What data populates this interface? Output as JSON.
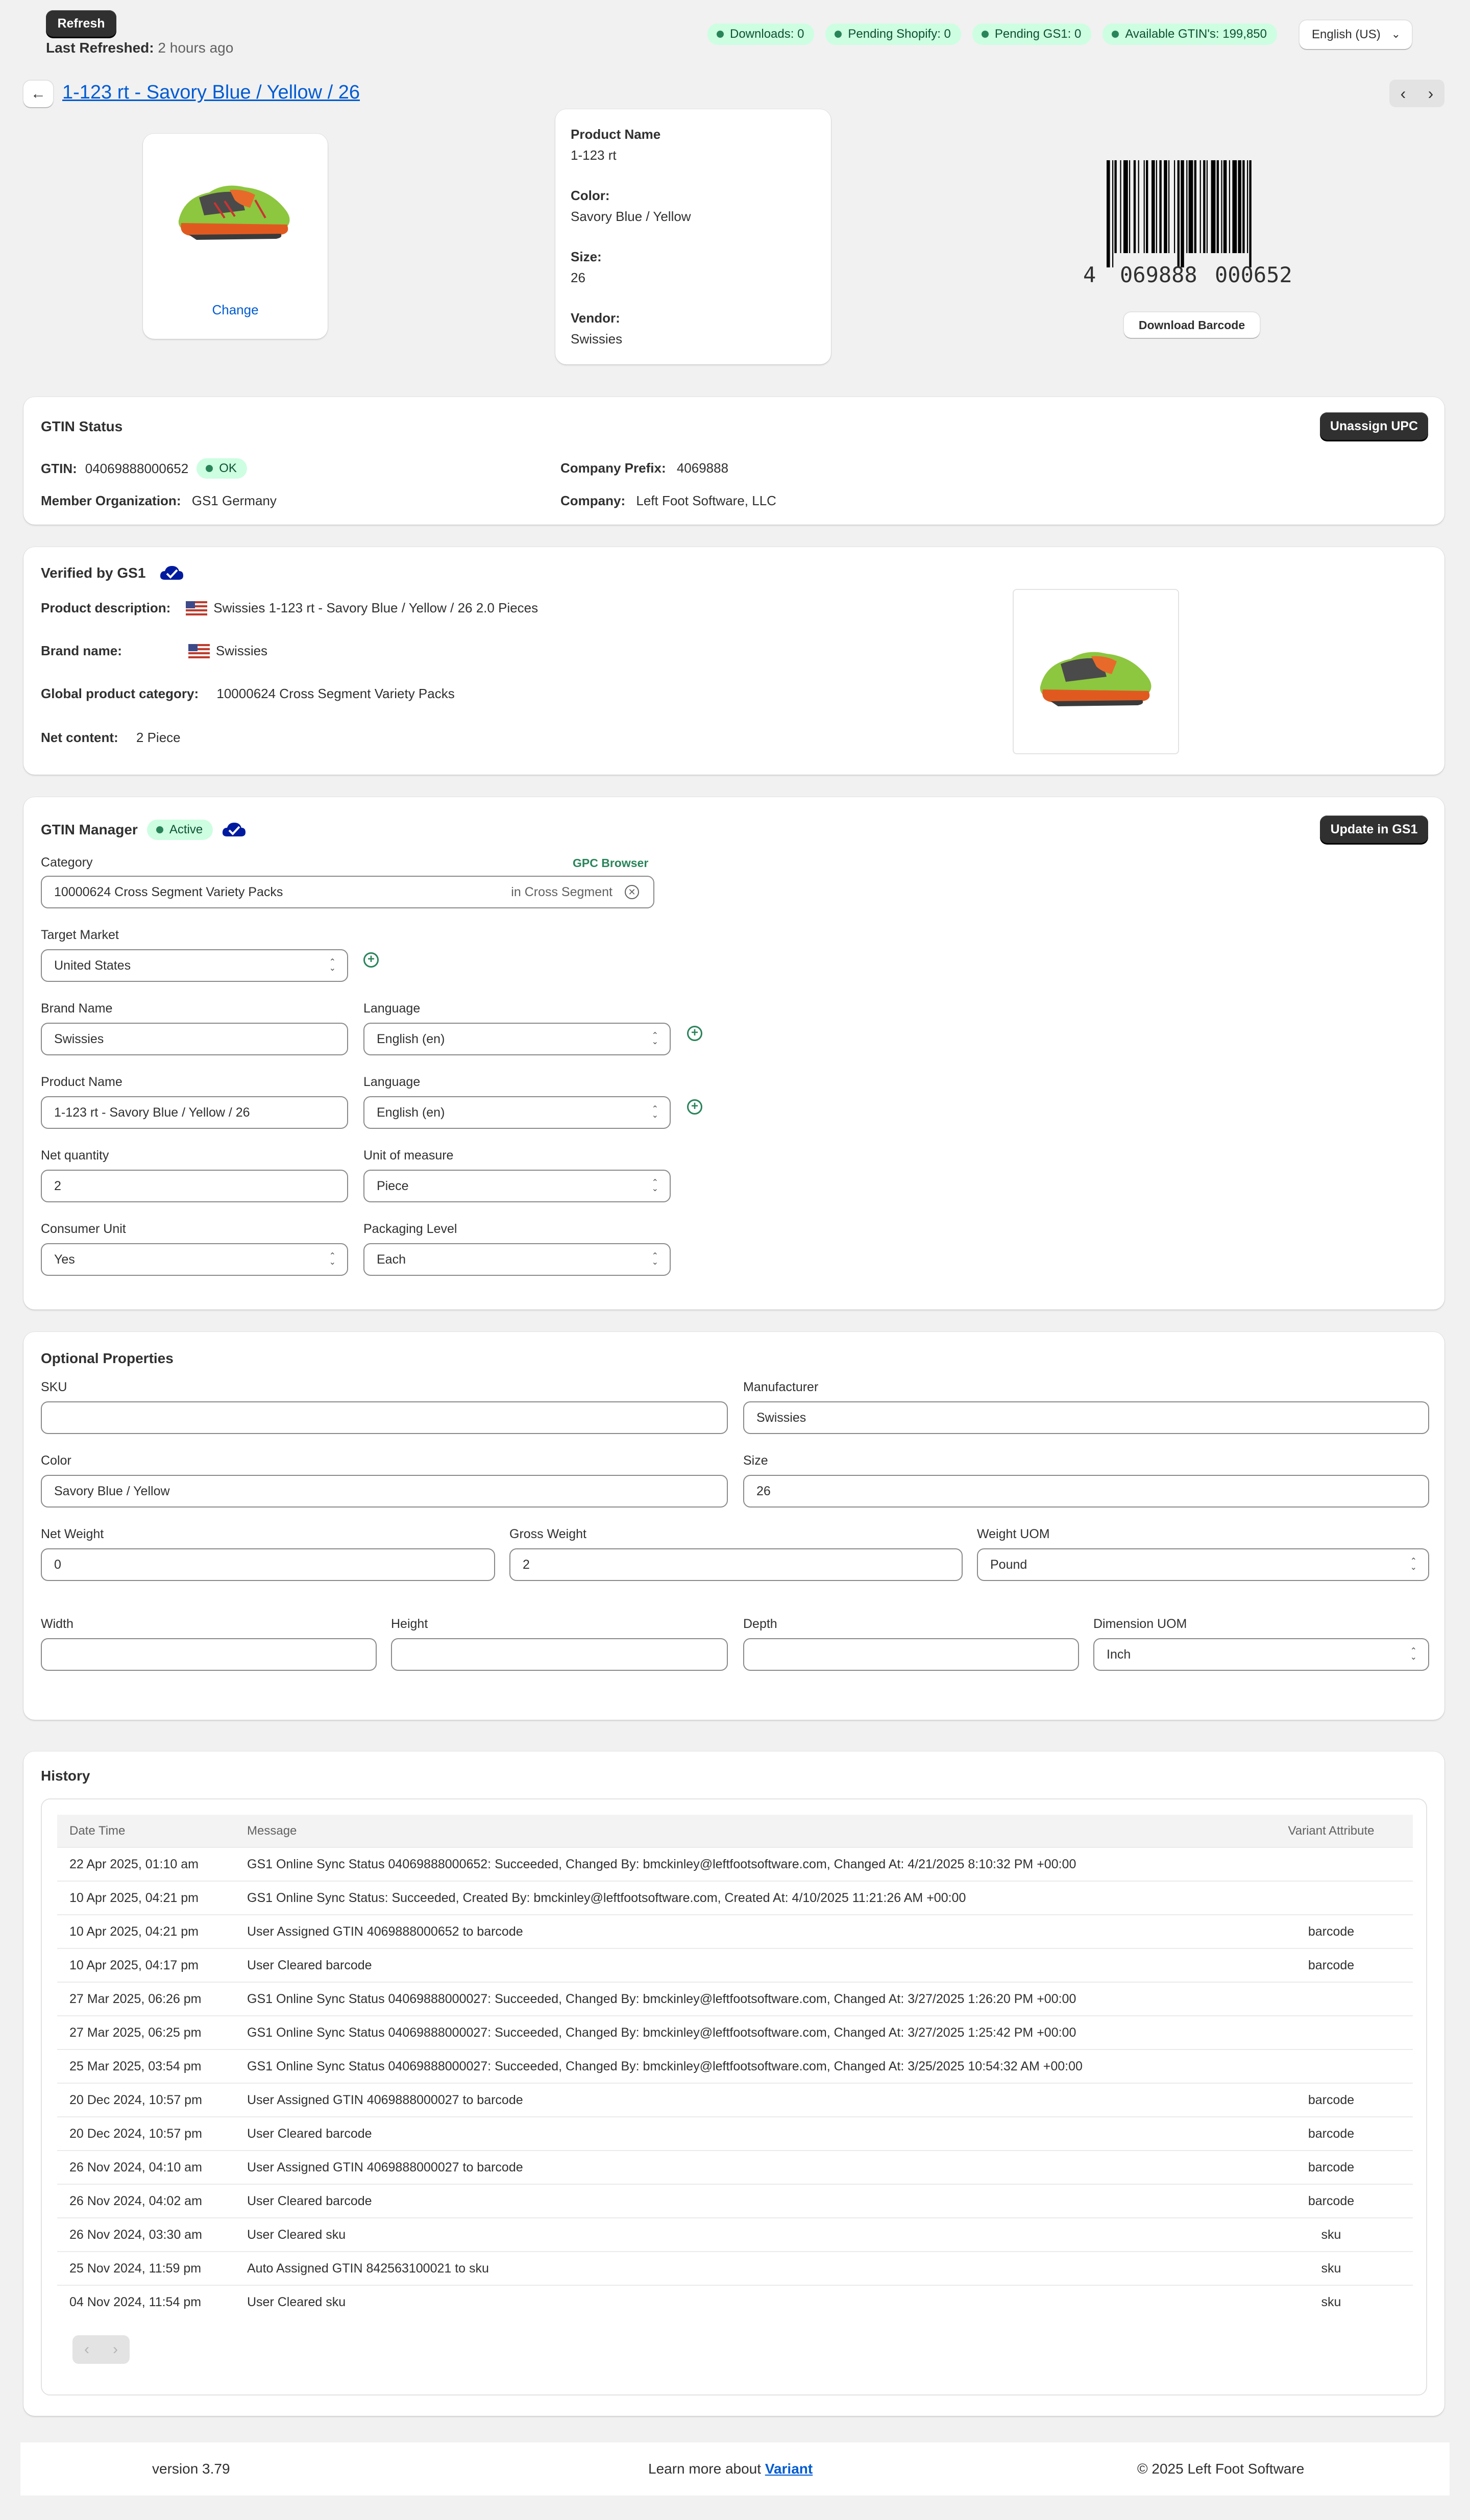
{
  "header": {
    "refresh_label": "Refresh",
    "last_refreshed_label": "Last Refreshed:",
    "last_refreshed_value": "2 hours ago",
    "badges": [
      "Downloads: 0",
      "Pending Shopify: 0",
      "Pending GS1: 0",
      "Available GTIN's: 199,850"
    ],
    "language": "English (US)"
  },
  "title": "1-123 rt - Savory Blue / Yellow / 26",
  "product": {
    "change_label": "Change",
    "name_label": "Product Name",
    "name": "1-123 rt",
    "color_label": "Color:",
    "color": "Savory Blue / Yellow",
    "size_label": "Size:",
    "size": "26",
    "vendor_label": "Vendor:",
    "vendor": "Swissies"
  },
  "barcode": {
    "digit_first": "4",
    "digits_left": "069888",
    "digits_right": "000652",
    "download_label": "Download Barcode"
  },
  "gtin_status": {
    "title": "GTIN Status",
    "unassign_label": "Unassign UPC",
    "gtin_label": "GTIN:",
    "gtin": "04069888000652",
    "status": "OK",
    "prefix_label": "Company Prefix:",
    "prefix": "4069888",
    "member_label": "Member Organization:",
    "member": "GS1 Germany",
    "company_label": "Company:",
    "company": "Left Foot Software, LLC"
  },
  "verified": {
    "title": "Verified by GS1",
    "desc_label": "Product description:",
    "desc": "Swissies 1-123 rt - Savory Blue / Yellow / 26 2.0 Pieces",
    "brand_label": "Brand name:",
    "brand": "Swissies",
    "category_label": "Global product category:",
    "category": "10000624 Cross Segment Variety Packs",
    "net_label": "Net content:",
    "net": "2 Piece"
  },
  "manager": {
    "title": "GTIN Manager",
    "status": "Active",
    "update_label": "Update in GS1",
    "category_label": "Category",
    "gpc_label": "GPC Browser",
    "category_value": "10000624 Cross Segment Variety Packs",
    "category_suffix": "in Cross Segment",
    "target_market_label": "Target Market",
    "target_market": "United States",
    "brand_label": "Brand Name",
    "brand": "Swissies",
    "language_label": "Language",
    "brand_language": "English (en)",
    "product_name_label": "Product Name",
    "product_name": "1-123 rt - Savory Blue / Yellow / 26",
    "product_language": "English (en)",
    "net_qty_label": "Net quantity",
    "net_qty": "2",
    "uom_label": "Unit of measure",
    "uom": "Piece",
    "consumer_label": "Consumer Unit",
    "consumer": "Yes",
    "packaging_label": "Packaging Level",
    "packaging": "Each"
  },
  "optional": {
    "title": "Optional Properties",
    "sku_label": "SKU",
    "sku": "",
    "manufacturer_label": "Manufacturer",
    "manufacturer": "Swissies",
    "color_label": "Color",
    "color": "Savory Blue / Yellow",
    "size_label": "Size",
    "size": "26",
    "net_weight_label": "Net Weight",
    "net_weight": "0",
    "gross_weight_label": "Gross Weight",
    "gross_weight": "2",
    "weight_uom_label": "Weight UOM",
    "weight_uom": "Pound",
    "width_label": "Width",
    "height_label": "Height",
    "depth_label": "Depth",
    "dimension_uom_label": "Dimension UOM",
    "dimension_uom": "Inch"
  },
  "history": {
    "title": "History",
    "columns": [
      "Date Time",
      "Message",
      "Variant Attribute"
    ],
    "rows": [
      [
        "22 Apr 2025, 01:10 am",
        "GS1 Online Sync Status 04069888000652: Succeeded, Changed By: bmckinley@leftfootsoftware.com, Changed At: 4/21/2025 8:10:32 PM +00:00",
        ""
      ],
      [
        "10 Apr 2025, 04:21 pm",
        "GS1 Online Sync Status: Succeeded, Created By: bmckinley@leftfootsoftware.com, Created At: 4/10/2025 11:21:26 AM +00:00",
        ""
      ],
      [
        "10 Apr 2025, 04:21 pm",
        "User Assigned GTIN 4069888000652 to barcode",
        "barcode"
      ],
      [
        "10 Apr 2025, 04:17 pm",
        "User Cleared barcode",
        "barcode"
      ],
      [
        "27 Mar 2025, 06:26 pm",
        "GS1 Online Sync Status 04069888000027: Succeeded, Changed By: bmckinley@leftfootsoftware.com, Changed At: 3/27/2025 1:26:20 PM +00:00",
        ""
      ],
      [
        "27 Mar 2025, 06:25 pm",
        "GS1 Online Sync Status 04069888000027: Succeeded, Changed By: bmckinley@leftfootsoftware.com, Changed At: 3/27/2025 1:25:42 PM +00:00",
        ""
      ],
      [
        "25 Mar 2025, 03:54 pm",
        "GS1 Online Sync Status 04069888000027: Succeeded, Changed By: bmckinley@leftfootsoftware.com, Changed At: 3/25/2025 10:54:32 AM +00:00",
        ""
      ],
      [
        "20 Dec 2024, 10:57 pm",
        "User Assigned GTIN 4069888000027 to barcode",
        "barcode"
      ],
      [
        "20 Dec 2024, 10:57 pm",
        "User Cleared barcode",
        "barcode"
      ],
      [
        "26 Nov 2024, 04:10 am",
        "User Assigned GTIN 4069888000027 to barcode",
        "barcode"
      ],
      [
        "26 Nov 2024, 04:02 am",
        "User Cleared barcode",
        "barcode"
      ],
      [
        "26 Nov 2024, 03:30 am",
        "User Cleared sku",
        "sku"
      ],
      [
        "25 Nov 2024, 11:59 pm",
        "Auto Assigned GTIN 842563100021 to sku",
        "sku"
      ],
      [
        "04 Nov 2024, 11:54 pm",
        "User Cleared sku",
        "sku"
      ]
    ]
  },
  "footer": {
    "version": "version 3.79",
    "learn_more": "Learn more about",
    "link": "Variant",
    "copyright": "© 2025 Left Foot Software"
  },
  "colors": {
    "accent": "#303030",
    "success": "#29845a",
    "link": "#005bd3",
    "verified_cloud": "#001a9f"
  }
}
